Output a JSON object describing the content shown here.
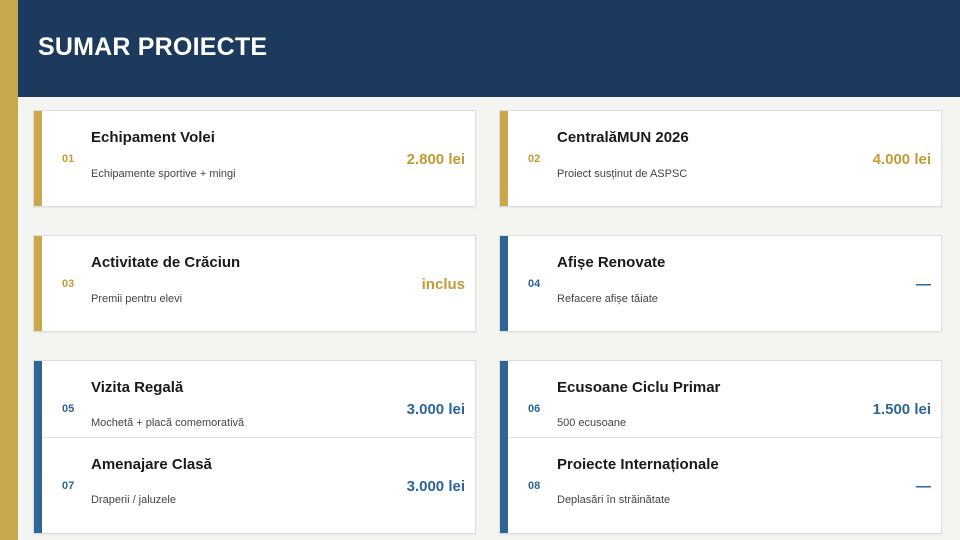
{
  "header": {
    "title": "SUMAR PROIECTE"
  },
  "colors": {
    "gold": "#c8a84b",
    "navy": "#1c3a5e",
    "blue": "#2d6596"
  },
  "projects": [
    {
      "num": "01",
      "title": "Echipament Volei",
      "desc": "Echipamente sportive + mingi",
      "amount": "2.800 lei"
    },
    {
      "num": "02",
      "title": "CentralăMUN 2026",
      "desc": "Proiect susținut de ASPSC",
      "amount": "4.000 lei"
    },
    {
      "num": "03",
      "title": "Activitate de Crăciun",
      "desc": "Premii pentru elevi",
      "amount": "inclus"
    },
    {
      "num": "04",
      "title": "Afișe Renovate",
      "desc": "Refacere afișe tăiate",
      "amount": "—"
    },
    {
      "num": "05",
      "title": "Vizita Regală",
      "desc": "Mochetă + placă comemorativă",
      "amount": "3.000 lei"
    },
    {
      "num": "06",
      "title": "Ecusoane Ciclu Primar",
      "desc": "500 ecusoane",
      "amount": "1.500 lei"
    },
    {
      "num": "07",
      "title": "Amenajare Clasă",
      "desc": "Draperii / jaluzele",
      "amount": "3.000 lei"
    },
    {
      "num": "08",
      "title": "Proiecte Internaționale",
      "desc": "Deplasări în străinătate",
      "amount": "—"
    }
  ]
}
